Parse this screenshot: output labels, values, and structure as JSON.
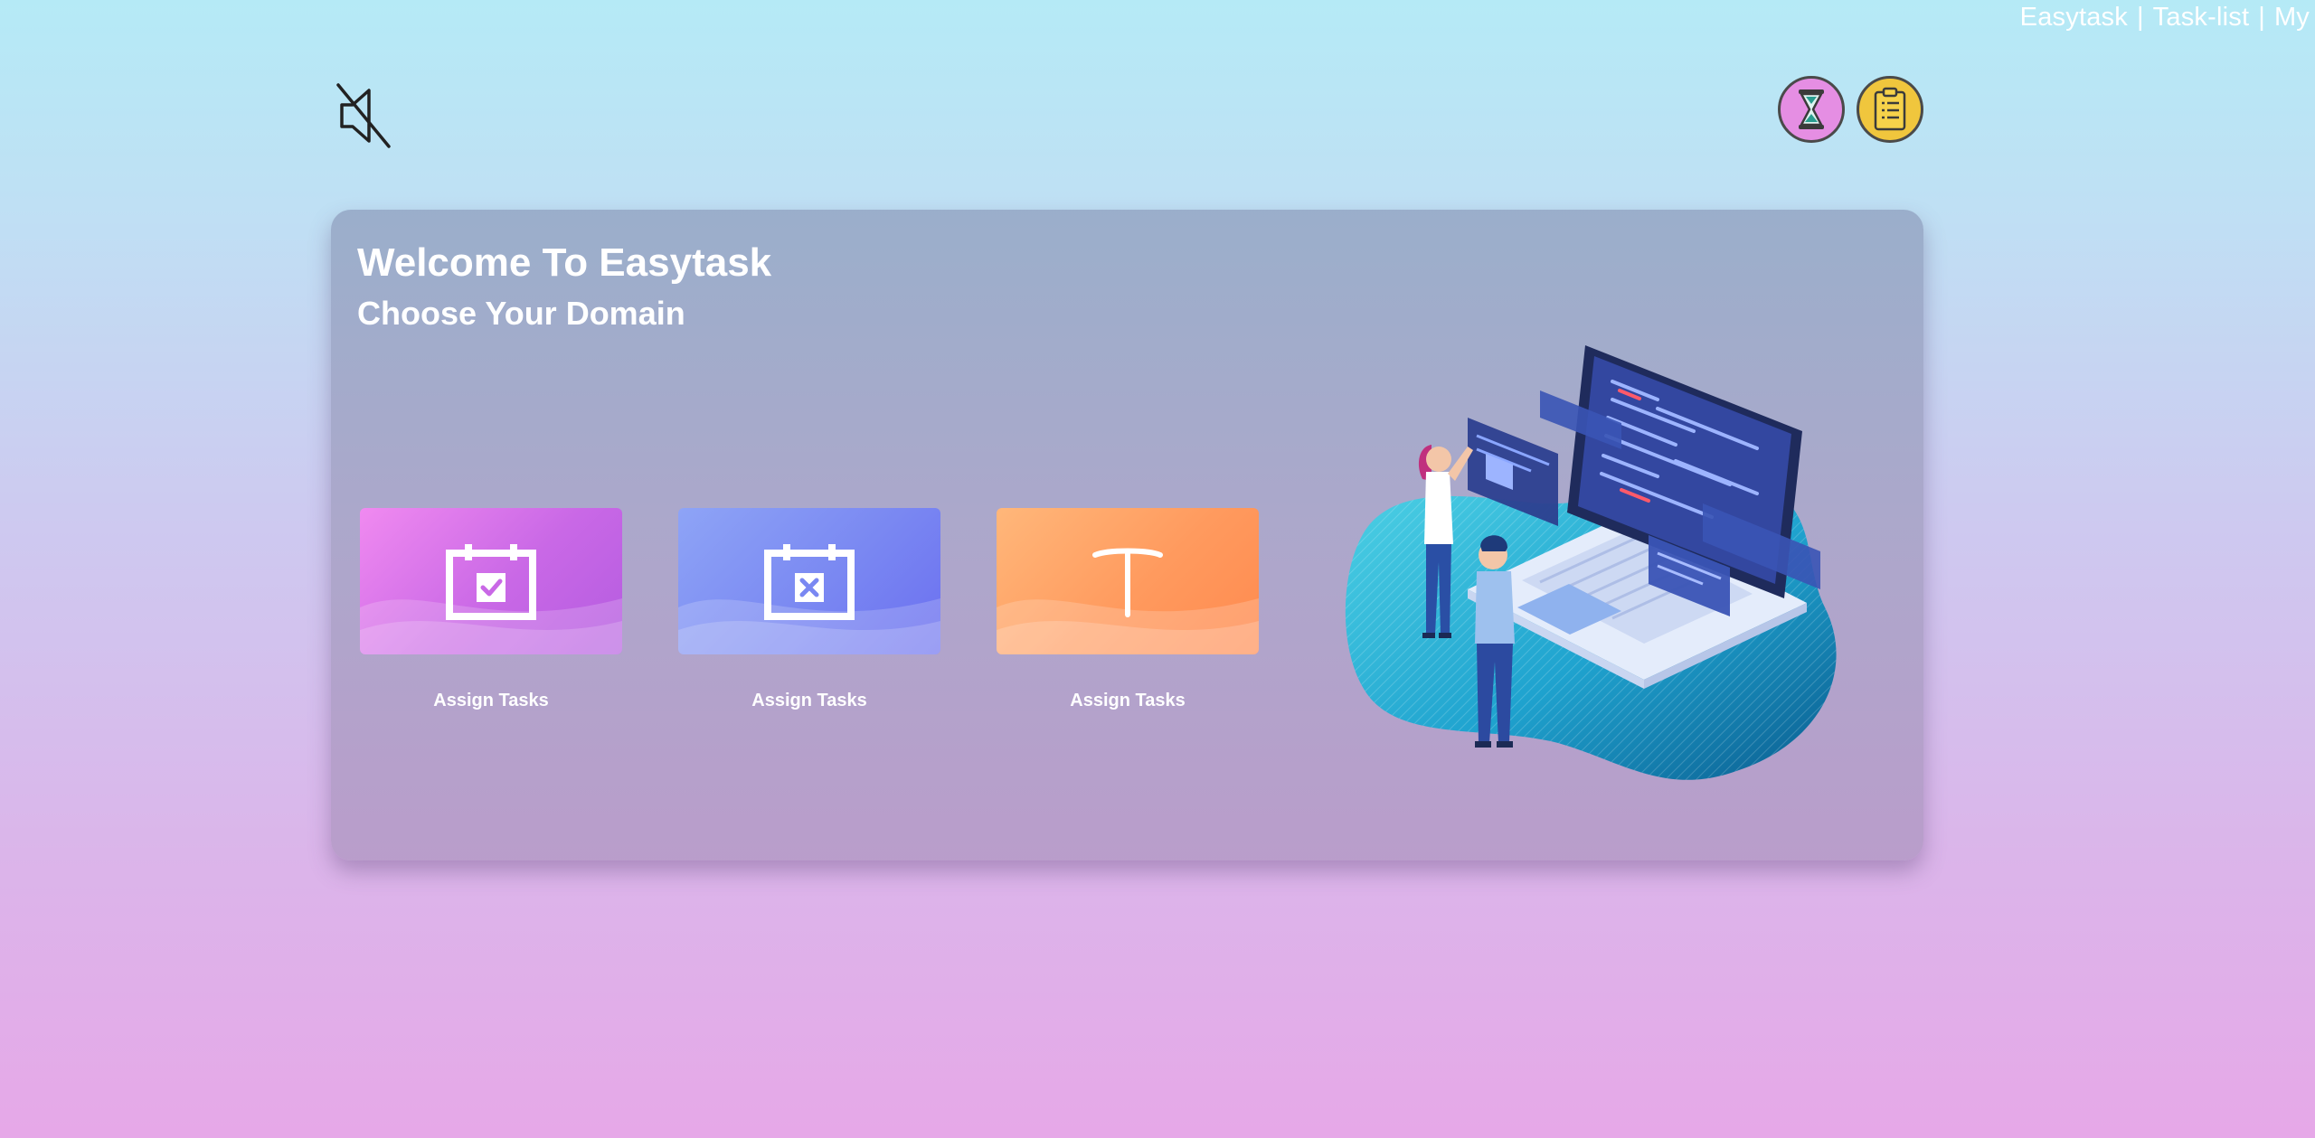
{
  "topbar": {
    "links": [
      "Easytask",
      "Task-list",
      "My"
    ],
    "separator": "|"
  },
  "header": {
    "mute_icon": "speaker-muted-icon",
    "timer_icon": "hourglass-icon",
    "tasklist_icon": "clipboard-icon"
  },
  "card": {
    "title": "Welcome To Easytask",
    "subtitle": "Choose Your Domain",
    "tiles": [
      {
        "label": "Assign Tasks",
        "icon": "calendar-check-icon"
      },
      {
        "label": "Assign Tasks",
        "icon": "calendar-cross-icon"
      },
      {
        "label": "Assign Tasks",
        "icon": "text-t-icon"
      }
    ]
  },
  "colors": {
    "timer_button": "#e58ee3",
    "tasklist_button": "#f0c63d",
    "tile_pink": "#c968e6",
    "tile_blue": "#7a88f2",
    "tile_orange": "#ff9a5e"
  }
}
